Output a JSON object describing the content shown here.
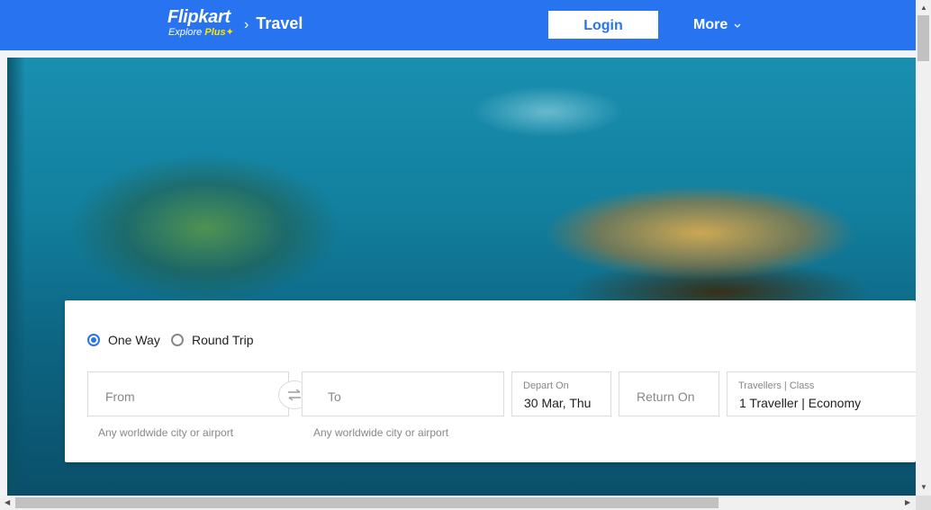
{
  "header": {
    "brand_name": "Flipkart",
    "brand_sub": "Explore",
    "brand_plus": "Plus",
    "breadcrumb_separator": "›",
    "breadcrumb": "Travel",
    "login_label": "Login",
    "more_label": "More",
    "colors": {
      "bar": "#2874f0",
      "plus": "#ffe500"
    }
  },
  "search": {
    "trip_types": [
      {
        "label": "One Way",
        "selected": true
      },
      {
        "label": "Round Trip",
        "selected": false
      }
    ],
    "from": {
      "placeholder": "From",
      "hint": "Any worldwide city or airport"
    },
    "to": {
      "placeholder": "To",
      "hint": "Any worldwide city or airport"
    },
    "depart": {
      "label": "Depart On",
      "value": "30 Mar, Thu"
    },
    "return": {
      "placeholder": "Return On"
    },
    "travellers": {
      "label": "Travellers | Class",
      "value": "1 Traveller | Economy"
    },
    "swap_icon": "swap-arrows-icon"
  }
}
